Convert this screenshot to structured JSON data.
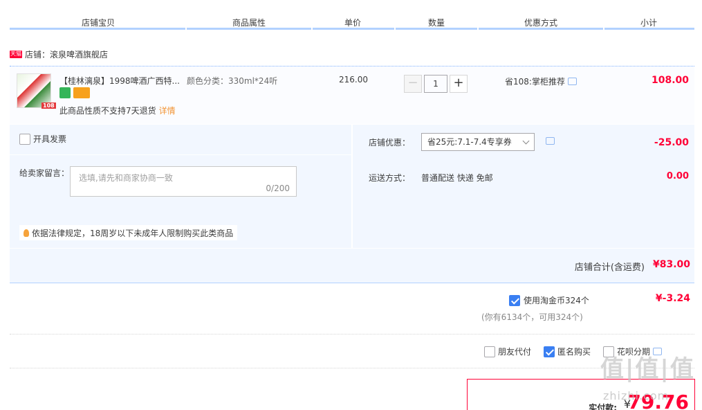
{
  "header": {
    "cols": [
      "店铺宝贝",
      "商品属性",
      "单价",
      "数量",
      "优惠方式",
      "小计"
    ]
  },
  "shop": {
    "badge": "天猫",
    "label": "店铺：滚泉啤酒旗舰店"
  },
  "item": {
    "thumb_tag": "108",
    "title": "【桂林漓泉】1998啤酒广西特...",
    "attr": "颜色分类：330ml*24听",
    "price": "216.00",
    "no_return": "此商品性质不支持7天退货",
    "detail_link": "详情",
    "qty_minus": "−",
    "qty_value": "1",
    "qty_plus": "+",
    "promo": "省108:掌柜推荐",
    "subtotal": "108.00"
  },
  "options": {
    "invoice_label": "开具发票",
    "message_label": "给卖家留言：",
    "message_placeholder": "选填,请先和商家协商一致",
    "message_count": "0/200",
    "law_notice": "依据法律规定，18周岁以下未成年人限制购买此类商品",
    "coupon_label": "店铺优惠：",
    "coupon_value": "省25元:7.1-7.4专享券",
    "coupon_discount": "-25.00",
    "ship_label": "运送方式：",
    "ship_value": "普通配送 快递 免邮",
    "ship_fee": "0.00"
  },
  "shop_total": {
    "label": "店铺合计(含运费)",
    "value": "¥83.00"
  },
  "coins": {
    "label": "使用淘金币324个",
    "value": "¥-3.24",
    "note": "(你有6134个，可用324个)"
  },
  "pay_options": [
    {
      "label": "朋友代付",
      "checked": false
    },
    {
      "label": "匿名购买",
      "checked": true
    },
    {
      "label": "花呗分期",
      "checked": false
    }
  ],
  "final": {
    "label": "实付款:",
    "yen": "¥",
    "value": "79.76"
  },
  "watermark": {
    "text": "值|值|值",
    "sub": "zhizhi.com"
  },
  "colors": {
    "accent_red": "#ff0036",
    "header_bar": "#b2d1ff",
    "panel_bg": "#f2f7ff",
    "checkbox_blue": "#3a7ff2"
  }
}
